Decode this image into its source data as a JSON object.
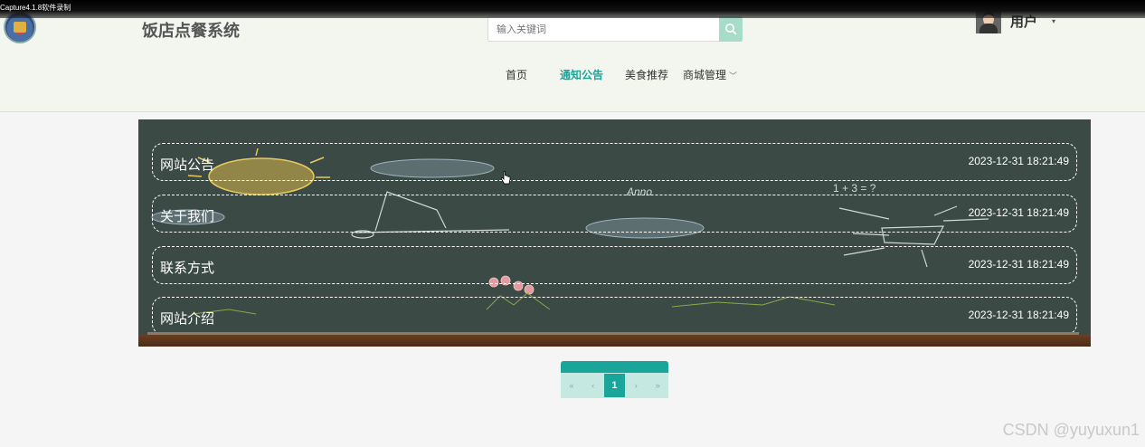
{
  "recorder": {
    "label": "Capture4.1.8软件录制"
  },
  "header": {
    "title": "饭店点餐系统",
    "search": {
      "placeholder": "输入关键词"
    },
    "user": {
      "name": "用户",
      "caret": "▾"
    }
  },
  "nav": {
    "items": [
      {
        "label": "首页"
      },
      {
        "label": "通知公告",
        "active": true
      },
      {
        "label": "美食推荐"
      },
      {
        "label": "商城管理",
        "has_dropdown": true
      }
    ],
    "dropdown_caret": "﹀"
  },
  "notices": [
    {
      "title": "网站公告",
      "date": "2023-12-31 18:21:49"
    },
    {
      "title": "关于我们",
      "date": "2023-12-31 18:21:49"
    },
    {
      "title": "联系方式",
      "date": "2023-12-31 18:21:49"
    },
    {
      "title": "网站介绍",
      "date": "2023-12-31 18:21:49"
    }
  ],
  "pagination": {
    "first": "«",
    "prev": "‹",
    "current": "1",
    "next": "›",
    "last": "»"
  },
  "watermark": "CSDN @yuyuxun1",
  "colors": {
    "accent": "#1aa59a",
    "header_bg": "#f2f6ee",
    "board_bg": "#3b4a45",
    "search_button": "#a6dcc9"
  },
  "icons": {
    "search": "search-icon",
    "logo": "site-logo",
    "avatar": "avatar",
    "cursor": "hand-cursor-icon"
  }
}
